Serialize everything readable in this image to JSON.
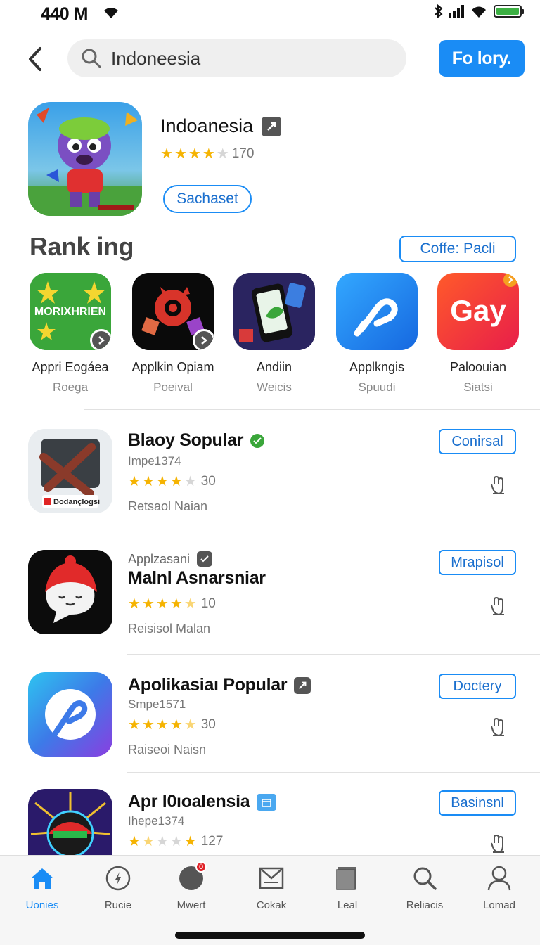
{
  "status_bar": {
    "time": "440 M"
  },
  "search": {
    "value": "Indoneesia"
  },
  "top_button": "Fo lory.",
  "featured": {
    "title": "Indoanesia",
    "rating": 4,
    "count": "170",
    "button": "Sachaset"
  },
  "ranking": {
    "title": "Rank ing",
    "button": "Coffe: Pacli",
    "items": [
      {
        "name": "Appri Eogáea",
        "sub": "Roega",
        "icon_text": "MORIXHRIEN"
      },
      {
        "name": "Applkin Opiam",
        "sub": "Poeival"
      },
      {
        "name": "Andiin",
        "sub": "Weicis"
      },
      {
        "name": "Applkngis",
        "sub": "Spuudi"
      },
      {
        "name": "Paloouian",
        "sub": "Siatsi",
        "icon_text": "Gay"
      }
    ]
  },
  "list": [
    {
      "top": "",
      "title": "Blaoy Sopular",
      "sub": "Impe1374",
      "rating": 4,
      "count": "30",
      "dev": "Retsaol Naian",
      "button": "Conirsal",
      "icon_caption": "Dodançlogsi"
    },
    {
      "top": "Applzasani",
      "title": "Malnl Asnarsniar",
      "sub": "",
      "rating": 4.5,
      "count": "10",
      "dev": "Reisisol Malan",
      "button": "Mrapisol"
    },
    {
      "top": "",
      "title": "Apolikasiaı Popular",
      "sub": "Smpe1571",
      "rating": 4.5,
      "count": "30",
      "dev": "Raiseoi Naisn",
      "button": "Doctery"
    },
    {
      "top": "",
      "title": "Apr l0ıoalensia",
      "sub": "Ihepe1374",
      "rating": 1.5,
      "count": "127",
      "dev": "",
      "button": "Basinsnl"
    }
  ],
  "tabs": [
    {
      "label": "Uonies",
      "icon": "home-icon"
    },
    {
      "label": "Rucie",
      "icon": "compass-icon"
    },
    {
      "label": "Mwert",
      "icon": "circle-icon",
      "badge": "0"
    },
    {
      "label": "Cokak",
      "icon": "mail-icon"
    },
    {
      "label": "Leal",
      "icon": "book-icon"
    },
    {
      "label": "Reliacis",
      "icon": "search-icon"
    },
    {
      "label": "Lomad",
      "icon": "person-icon"
    }
  ],
  "colors": {
    "accent": "#1a8cf5",
    "star": "#f5b301",
    "divider": "#e1e1e1"
  }
}
